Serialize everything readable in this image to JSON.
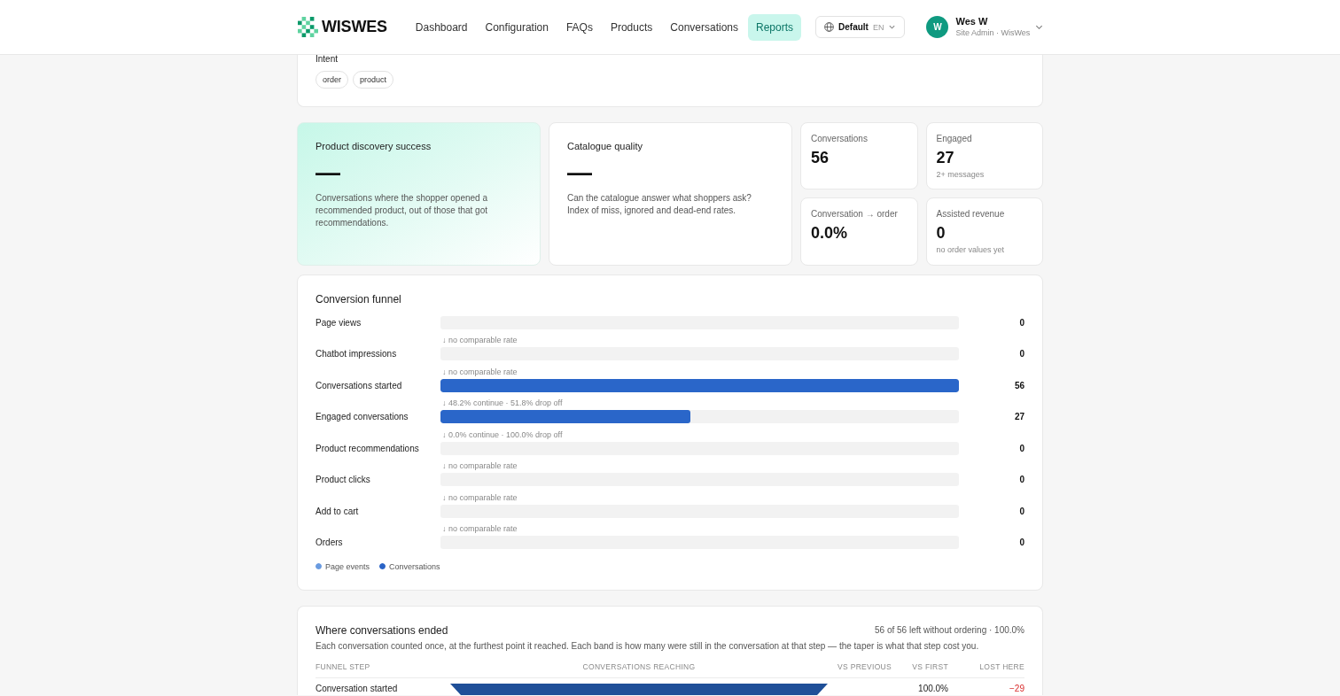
{
  "header": {
    "brand": "WISWES",
    "nav": [
      {
        "label": "Dashboard",
        "selected": false
      },
      {
        "label": "Configuration",
        "selected": false
      },
      {
        "label": "FAQs",
        "selected": false
      },
      {
        "label": "Products",
        "selected": false
      },
      {
        "label": "Conversations",
        "selected": false
      },
      {
        "label": "Reports",
        "selected": true
      }
    ],
    "workspace_selector": {
      "label": "Default",
      "language": "EN"
    },
    "user": {
      "initial": "W",
      "name": "Wes W",
      "role": "Site Admin · WisWes"
    }
  },
  "intent_filter": {
    "label": "Intent",
    "chips": [
      "order",
      "product"
    ]
  },
  "highlight_cards": [
    {
      "kind": "accent",
      "title": "Product discovery success",
      "value": "—",
      "description": "Conversations where the shopper opened a recommended product, out of those that got recommendations."
    },
    {
      "kind": "plain",
      "title": "Catalogue quality",
      "value": "—",
      "description": "Can the catalogue answer what shoppers ask? Index of miss, ignored and dead-end rates."
    }
  ],
  "stats": [
    {
      "label": "Conversations",
      "value": "56"
    },
    {
      "label": "Engaged",
      "value": "27",
      "note": "2+ messages"
    },
    {
      "label": "Conversation → order",
      "value": "0.0%"
    },
    {
      "label": "Assisted revenue",
      "value": "0",
      "note": "no order values yet"
    }
  ],
  "conversion_funnel": {
    "title": "Conversion funnel",
    "steps": [
      {
        "label": "Page views",
        "value": "0",
        "rate": "↓ no comparable rate"
      },
      {
        "label": "Chatbot impressions",
        "value": "0",
        "rate": "↓ no comparable rate"
      },
      {
        "label": "Conversations started",
        "level": 1,
        "value": "56",
        "rate": "↓ 48.2% continue · 51.8% drop off"
      },
      {
        "label": "Engaged conversations",
        "level": 0.482,
        "value": "27",
        "rate": "↓ 0.0% continue · 100.0% drop off"
      },
      {
        "label": "Product recommendations",
        "value": "0",
        "rate": "↓ no comparable rate"
      },
      {
        "label": "Product clicks",
        "value": "0",
        "rate": "↓ no comparable rate"
      },
      {
        "label": "Add to cart",
        "value": "0",
        "rate": "↓ no comparable rate"
      },
      {
        "label": "Orders",
        "value": "0"
      }
    ],
    "legend": [
      {
        "label": "Page events",
        "color": "#6a9be0"
      },
      {
        "label": "Conversations",
        "color": "#2a63c6"
      }
    ]
  },
  "where_ended": {
    "title": "Where conversations ended",
    "summary": "56 of 56 left without ordering · 100.0%",
    "description": "Each conversation counted once, at the furthest point it reached. Each band is how many were still in the conversation at that step — the taper is what that step cost you.",
    "columns": [
      "FUNNEL STEP",
      "CONVERSATIONS REACHING",
      "VS PREVIOUS",
      "VS FIRST",
      "LOST HERE"
    ],
    "rows": [
      {
        "step": "Conversation started",
        "vs_first": "100.0%",
        "lost_here": "−29"
      }
    ]
  }
}
